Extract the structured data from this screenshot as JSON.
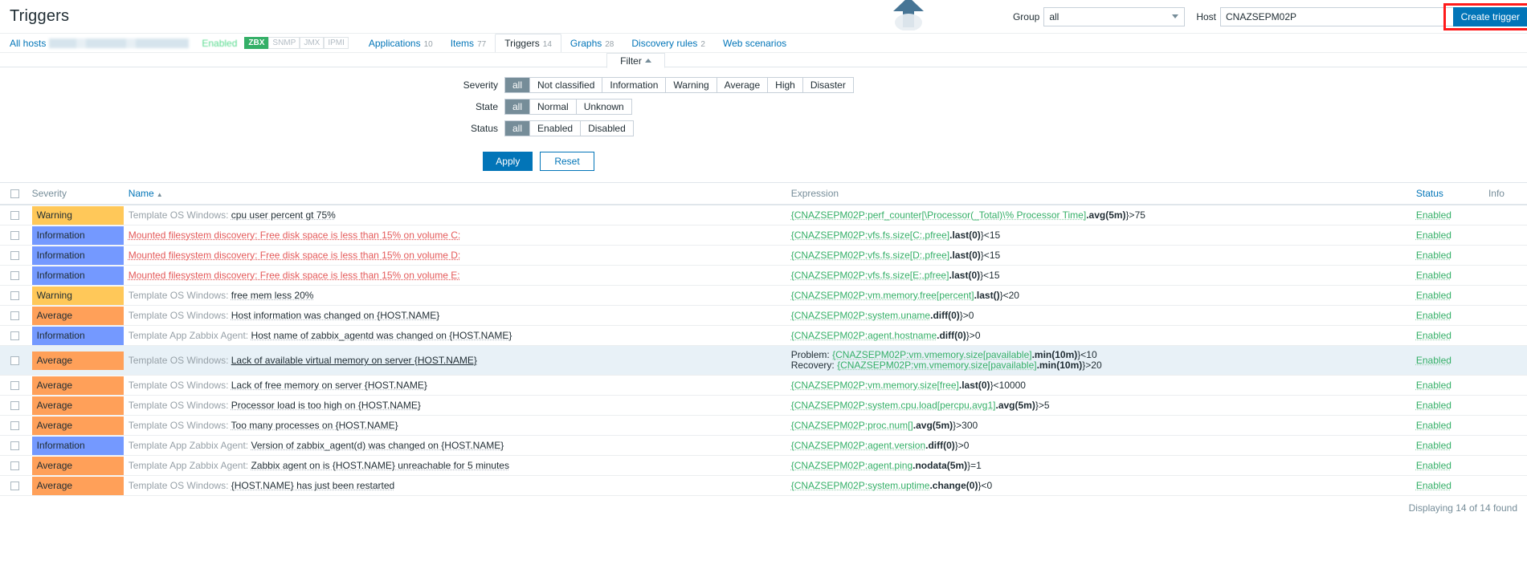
{
  "header": {
    "page_title": "Triggers",
    "group_label": "Group",
    "group_value": "all",
    "host_label": "Host",
    "host_value": "CNAZSEPM02P",
    "create_button": "Create trigger"
  },
  "subnav": {
    "all_hosts_label": "All hosts",
    "host_name_redacted": "",
    "status_label": "Enabled",
    "interfaces": [
      "ZBX",
      "SNMP",
      "JMX",
      "IPMI"
    ],
    "tabs": [
      {
        "label": "Applications",
        "count": "10",
        "active": false
      },
      {
        "label": "Items",
        "count": "77",
        "active": false
      },
      {
        "label": "Triggers",
        "count": "14",
        "active": true
      },
      {
        "label": "Graphs",
        "count": "28",
        "active": false
      },
      {
        "label": "Discovery rules",
        "count": "2",
        "active": false
      },
      {
        "label": "Web scenarios",
        "count": "",
        "active": false
      }
    ]
  },
  "filter": {
    "tab_label": "Filter",
    "severity": {
      "label": "Severity",
      "options": [
        "all",
        "Not classified",
        "Information",
        "Warning",
        "Average",
        "High",
        "Disaster"
      ],
      "selected": "all"
    },
    "state": {
      "label": "State",
      "options": [
        "all",
        "Normal",
        "Unknown"
      ],
      "selected": "all"
    },
    "status": {
      "label": "Status",
      "options": [
        "all",
        "Enabled",
        "Disabled"
      ],
      "selected": "all"
    },
    "apply_label": "Apply",
    "reset_label": "Reset"
  },
  "table": {
    "columns": {
      "severity": "Severity",
      "name": "Name",
      "expression": "Expression",
      "status": "Status",
      "info": "Info"
    },
    "sort_indicator": "▲",
    "rows": [
      {
        "severity": "Warning",
        "severity_class": "sev-warning",
        "template": "Template OS Windows:",
        "template_style": "tpl",
        "name": "cpu user percent gt 75%",
        "expression_prefix": "",
        "expr_host": "{CNAZSEPM02P:perf_counter[\\Processor(_Total)\\% Processor Time]",
        "expr_func": ".avg(5m)",
        "expr_tail": "}>75",
        "status": "Enabled",
        "highlight": false
      },
      {
        "severity": "Information",
        "severity_class": "sev-information",
        "template": "Mounted filesystem discovery:",
        "template_style": "disc",
        "name": "Free disk space is less than 15% on volume C:",
        "expression_prefix": "",
        "expr_host": "{CNAZSEPM02P:vfs.fs.size[C:,pfree]",
        "expr_func": ".last(0)",
        "expr_tail": "}<15",
        "status": "Enabled",
        "highlight": false
      },
      {
        "severity": "Information",
        "severity_class": "sev-information",
        "template": "Mounted filesystem discovery:",
        "template_style": "disc",
        "name": "Free disk space is less than 15% on volume D:",
        "expression_prefix": "",
        "expr_host": "{CNAZSEPM02P:vfs.fs.size[D:,pfree]",
        "expr_func": ".last(0)",
        "expr_tail": "}<15",
        "status": "Enabled",
        "highlight": false
      },
      {
        "severity": "Information",
        "severity_class": "sev-information",
        "template": "Mounted filesystem discovery:",
        "template_style": "disc",
        "name": "Free disk space is less than 15% on volume E:",
        "expression_prefix": "",
        "expr_host": "{CNAZSEPM02P:vfs.fs.size[E:,pfree]",
        "expr_func": ".last(0)",
        "expr_tail": "}<15",
        "status": "Enabled",
        "highlight": false
      },
      {
        "severity": "Warning",
        "severity_class": "sev-warning",
        "template": "Template OS Windows:",
        "template_style": "tpl",
        "name": "free mem less 20%",
        "expression_prefix": "",
        "expr_host": "{CNAZSEPM02P:vm.memory.free[percent]",
        "expr_func": ".last()",
        "expr_tail": "}<20",
        "status": "Enabled",
        "highlight": false
      },
      {
        "severity": "Average",
        "severity_class": "sev-average",
        "template": "Template OS Windows:",
        "template_style": "tpl",
        "name": "Host information was changed on {HOST.NAME}",
        "expression_prefix": "",
        "expr_host": "{CNAZSEPM02P:system.uname",
        "expr_func": ".diff(0)",
        "expr_tail": "}>0",
        "status": "Enabled",
        "highlight": false
      },
      {
        "severity": "Information",
        "severity_class": "sev-information",
        "template": "Template App Zabbix Agent:",
        "template_style": "tpl",
        "name": "Host name of zabbix_agentd was changed on {HOST.NAME}",
        "expression_prefix": "",
        "expr_host": "{CNAZSEPM02P:agent.hostname",
        "expr_func": ".diff(0)",
        "expr_tail": "}>0",
        "status": "Enabled",
        "highlight": false
      },
      {
        "severity": "Average",
        "severity_class": "sev-average",
        "template": "Template OS Windows:",
        "template_style": "tpl",
        "name": "Lack of available virtual memory on server {HOST.NAME}",
        "name_solid": true,
        "expression_prefix": "Problem:",
        "expr_host": "{CNAZSEPM02P:vm.vmemory.size[pavailable]",
        "expr_func": ".min(10m)",
        "expr_tail": "}<10",
        "recovery_prefix": "Recovery:",
        "recovery_host": "{CNAZSEPM02P:vm.vmemory.size[pavailable]",
        "recovery_func": ".min(10m)",
        "recovery_tail": "}>20",
        "status": "Enabled",
        "highlight": true
      },
      {
        "severity": "Average",
        "severity_class": "sev-average",
        "template": "Template OS Windows:",
        "template_style": "tpl",
        "name": "Lack of free memory on server {HOST.NAME}",
        "expression_prefix": "",
        "expr_host": "{CNAZSEPM02P:vm.memory.size[free]",
        "expr_func": ".last(0)",
        "expr_tail": "}<10000",
        "status": "Enabled",
        "highlight": false
      },
      {
        "severity": "Average",
        "severity_class": "sev-average",
        "template": "Template OS Windows:",
        "template_style": "tpl",
        "name": "Processor load is too high on {HOST.NAME}",
        "expression_prefix": "",
        "expr_host": "{CNAZSEPM02P:system.cpu.load[percpu,avg1]",
        "expr_func": ".avg(5m)",
        "expr_tail": "}>5",
        "status": "Enabled",
        "highlight": false
      },
      {
        "severity": "Average",
        "severity_class": "sev-average",
        "template": "Template OS Windows:",
        "template_style": "tpl",
        "name": "Too many processes on {HOST.NAME}",
        "expression_prefix": "",
        "expr_host": "{CNAZSEPM02P:proc.num[]",
        "expr_func": ".avg(5m)",
        "expr_tail": "}>300",
        "status": "Enabled",
        "highlight": false
      },
      {
        "severity": "Information",
        "severity_class": "sev-information",
        "template": "Template App Zabbix Agent:",
        "template_style": "tpl",
        "name": "Version of zabbix_agent(d) was changed on {HOST.NAME}",
        "expression_prefix": "",
        "expr_host": "{CNAZSEPM02P:agent.version",
        "expr_func": ".diff(0)",
        "expr_tail": "}>0",
        "status": "Enabled",
        "highlight": false
      },
      {
        "severity": "Average",
        "severity_class": "sev-average",
        "template": "Template App Zabbix Agent:",
        "template_style": "tpl",
        "name": "Zabbix agent on is {HOST.NAME} unreachable for 5 minutes",
        "expression_prefix": "",
        "expr_host": "{CNAZSEPM02P:agent.ping",
        "expr_func": ".nodata(5m)",
        "expr_tail": "}=1",
        "status": "Enabled",
        "highlight": false
      },
      {
        "severity": "Average",
        "severity_class": "sev-average",
        "template": "Template OS Windows:",
        "template_style": "tpl",
        "name": "{HOST.NAME} has just been restarted",
        "expression_prefix": "",
        "expr_host": "{CNAZSEPM02P:system.uptime",
        "expr_func": ".change(0)",
        "expr_tail": "}<0",
        "status": "Enabled",
        "highlight": false
      }
    ],
    "footer": "Displaying 14 of 14 found"
  },
  "colors": {
    "accent": "#0275b8",
    "warning": "#ffc859",
    "information": "#7499ff",
    "average": "#ffa059",
    "enabled_green": "#34af67",
    "highlight_red": "#ff1a1a"
  }
}
